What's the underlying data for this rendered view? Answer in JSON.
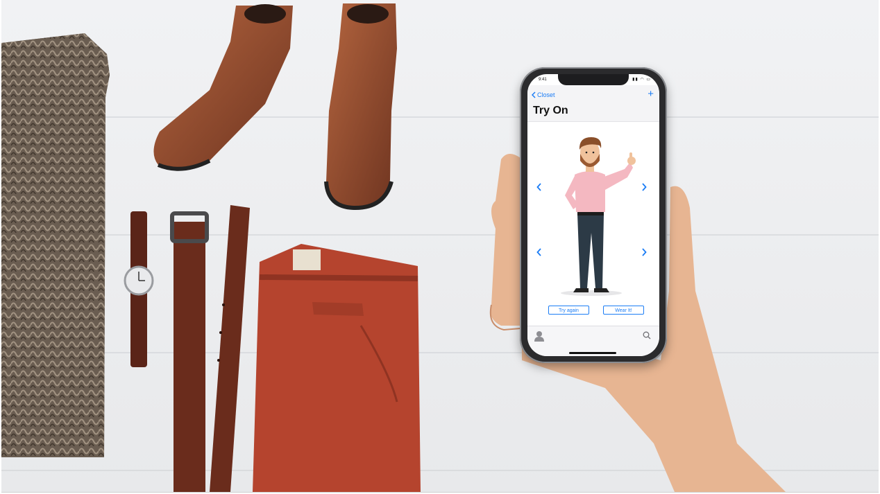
{
  "status": {
    "time": "9:41",
    "icons": "▮▮ ◠ ▭"
  },
  "navbar": {
    "back_label": "Closet",
    "add_label": "+",
    "title": "Try On"
  },
  "actions": {
    "try_again_label": "Try again",
    "wear_it_label": "Wear It!"
  },
  "icons": {
    "back": "chevron-left-icon",
    "add": "plus-icon",
    "arrow_left": "chevron-left-icon",
    "arrow_right": "chevron-right-icon",
    "tab_profile": "person-icon",
    "tab_search": "search-icon"
  },
  "colors": {
    "accent": "#1a7cf5",
    "shirt": "#f4b8c1",
    "pants": "#2c3a46",
    "beard": "#9a5a32"
  }
}
